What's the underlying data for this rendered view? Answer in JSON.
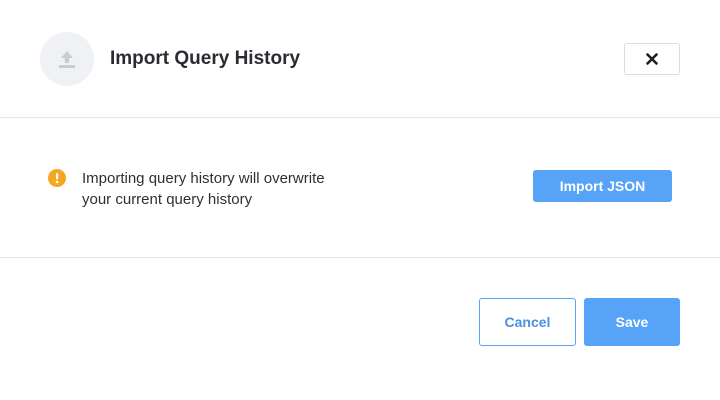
{
  "dialog": {
    "title": "Import Query History",
    "header_icon": "upload-icon",
    "close_icon": "close-icon"
  },
  "body": {
    "warning_icon": "warning-icon",
    "warning_text": "Importing query history will overwrite your current query history",
    "import_label": "Import JSON"
  },
  "footer": {
    "cancel_label": "Cancel",
    "save_label": "Save"
  },
  "colors": {
    "accent": "#57a3f7",
    "warning": "#f5a623",
    "icon_bg": "#eff1f4",
    "border": "#e6e8eb"
  }
}
